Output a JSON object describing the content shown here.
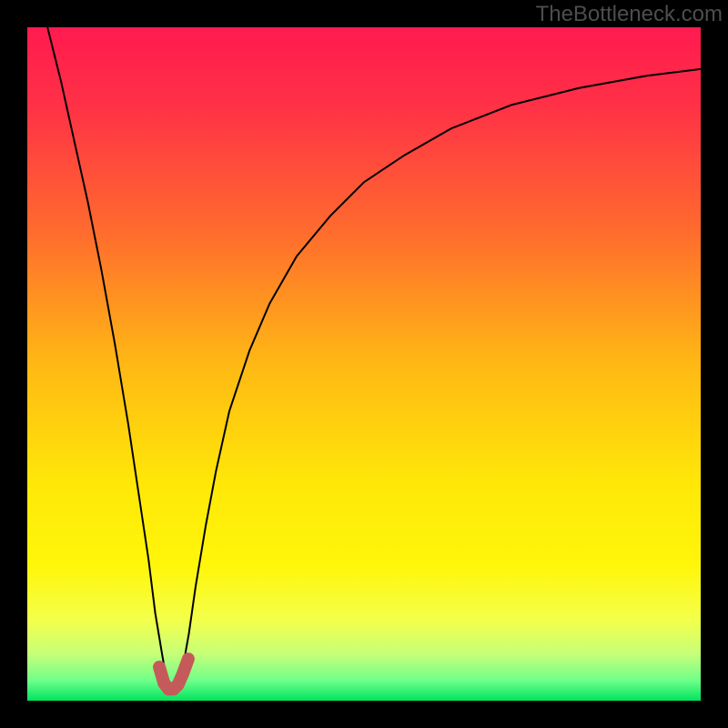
{
  "watermark": "TheBottleneck.com",
  "chart_data": {
    "type": "line",
    "title": "",
    "xlabel": "",
    "ylabel": "",
    "xlim": [
      0,
      100
    ],
    "ylim": [
      0,
      100
    ],
    "background_gradient": {
      "stops": [
        {
          "offset": 0.0,
          "color": "#ff1a4f"
        },
        {
          "offset": 0.12,
          "color": "#ff3246"
        },
        {
          "offset": 0.3,
          "color": "#ff6a2e"
        },
        {
          "offset": 0.5,
          "color": "#ffb814"
        },
        {
          "offset": 0.68,
          "color": "#ffe808"
        },
        {
          "offset": 0.8,
          "color": "#fff60a"
        },
        {
          "offset": 0.88,
          "color": "#f3ff4a"
        },
        {
          "offset": 0.93,
          "color": "#c7ff78"
        },
        {
          "offset": 0.97,
          "color": "#6fff8a"
        },
        {
          "offset": 1.0,
          "color": "#00e45e"
        }
      ]
    },
    "series": [
      {
        "name": "bottleneck-curve",
        "color": "#000000",
        "stroke_width": 2,
        "x": [
          3,
          5,
          7,
          9,
          11,
          13,
          15,
          16.5,
          18,
          19,
          20,
          20.6,
          21.2,
          21.8,
          22.5,
          23.2,
          24,
          25,
          26.5,
          28,
          30,
          33,
          36,
          40,
          45,
          50,
          56,
          63,
          72,
          82,
          92,
          100
        ],
        "values": [
          100,
          92,
          83,
          74,
          64,
          53,
          41,
          31,
          21,
          13,
          7,
          3.5,
          2,
          2,
          3,
          5.5,
          10,
          17,
          26,
          34,
          43,
          52,
          59,
          66,
          72,
          77,
          81,
          85,
          88.5,
          91,
          92.8,
          93.8
        ]
      },
      {
        "name": "highlight-dip",
        "color": "#c55a5a",
        "stroke_width": 14,
        "stroke_linecap": "round",
        "x": [
          19.6,
          20.3,
          21.0,
          21.7,
          22.4,
          23.1,
          23.9
        ],
        "values": [
          5.0,
          2.6,
          1.7,
          1.7,
          2.4,
          4.0,
          6.2
        ]
      }
    ]
  }
}
